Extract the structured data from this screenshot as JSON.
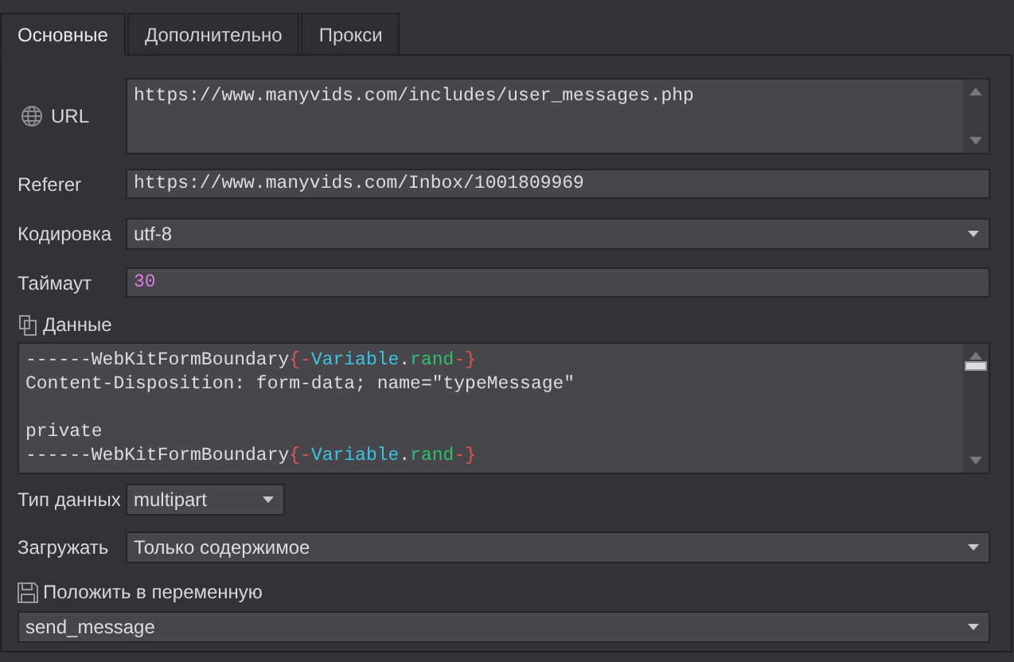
{
  "tabs": [
    {
      "label": "Основные",
      "selected": true
    },
    {
      "label": "Дополнительно",
      "selected": false
    },
    {
      "label": "Прокси",
      "selected": false
    }
  ],
  "fields": [
    {
      "kind": "textarea",
      "label": "URL",
      "value": "https://www.manyvids.com/includes/user_messages.php"
    },
    {
      "kind": "input",
      "label": "Referer",
      "value": "https://www.manyvids.com/Inbox/1001809969"
    },
    {
      "kind": "select",
      "label": "Кодировка",
      "value": "utf-8"
    },
    {
      "kind": "number",
      "label": "Таймаут",
      "value": "30"
    }
  ],
  "data": {
    "label": "Данные",
    "lines": [
      {
        "kind": "code",
        "segments": [
          {
            "kind": "plain",
            "text": "------WebKitFormBoundary"
          },
          {
            "kind": "brace",
            "text": "{-"
          },
          {
            "kind": "variable",
            "text": "Variable"
          },
          {
            "kind": "plain",
            "text": "."
          },
          {
            "kind": "property",
            "text": "rand"
          },
          {
            "kind": "brace",
            "text": "-}"
          }
        ]
      },
      {
        "kind": "code",
        "segments": [
          {
            "kind": "plain",
            "text": "Content-Disposition: form-data; name=\"typeMessage\""
          }
        ]
      },
      {
        "kind": "blank"
      },
      {
        "kind": "code",
        "segments": [
          {
            "kind": "plain",
            "text": "private"
          }
        ]
      },
      {
        "kind": "code",
        "segments": [
          {
            "kind": "plain",
            "text": "------WebKitFormBoundary"
          },
          {
            "kind": "brace",
            "text": "{-"
          },
          {
            "kind": "variable",
            "text": "Variable"
          },
          {
            "kind": "plain",
            "text": "."
          },
          {
            "kind": "property",
            "text": "rand"
          },
          {
            "kind": "brace",
            "text": "-}"
          }
        ]
      }
    ]
  },
  "data_type": {
    "label": "Тип данных",
    "value": "multipart"
  },
  "load": {
    "label": "Загружать",
    "value": "Только содержимое"
  },
  "save_to": {
    "label": "Положить в переменную",
    "value": "send_message"
  }
}
